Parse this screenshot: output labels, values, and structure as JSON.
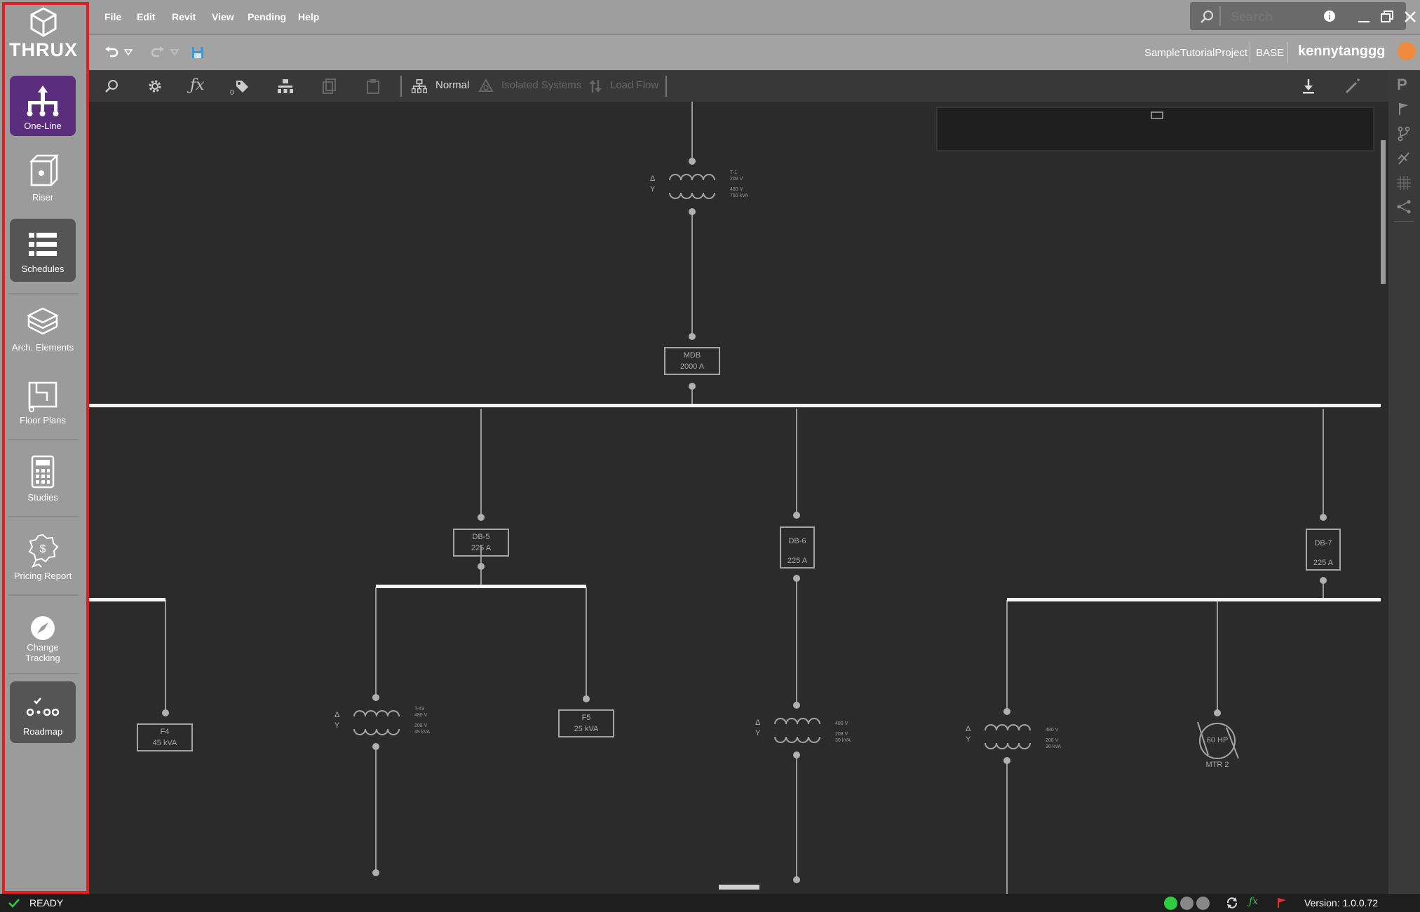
{
  "app": {
    "logo_text": "THRUX",
    "project_name": "SampleTutorialProject",
    "branch": "BASE",
    "username": "kennytanggg"
  },
  "menu": [
    "File",
    "Edit",
    "Revit",
    "View",
    "Pending",
    "Help"
  ],
  "search": {
    "placeholder": "Search"
  },
  "sidebar": {
    "items": [
      {
        "label": "One-Line",
        "icon": "one-line-icon"
      },
      {
        "label": "Riser",
        "icon": "riser-icon"
      },
      {
        "label": "Schedules",
        "icon": "schedules-icon"
      },
      {
        "label": "Arch. Elements",
        "icon": "arch-elements-icon"
      },
      {
        "label": "Floor Plans",
        "icon": "floor-plans-icon"
      },
      {
        "label": "Studies",
        "icon": "calculator-icon"
      },
      {
        "label": "Pricing Report",
        "icon": "pricing-icon"
      },
      {
        "label": "Change Tracking",
        "icon": "compass-icon"
      },
      {
        "label": "Roadmap",
        "icon": "roadmap-icon"
      }
    ]
  },
  "toolbar": {
    "tag_count": "0",
    "mode_normal": "Normal",
    "mode_isolated": "Isolated Systems",
    "mode_loadflow": "Load Flow"
  },
  "diagram": {
    "transformer_t1": {
      "name": "T-1",
      "primary": "208 V",
      "secondary": "480 V",
      "rating": "750 kVA"
    },
    "mdb": {
      "name": "MDB",
      "rating": "2000 A"
    },
    "db5": {
      "name": "DB-5",
      "rating": "225 A"
    },
    "db6": {
      "name": "DB-6",
      "rating": "225 A"
    },
    "db7": {
      "name": "DB-7",
      "rating": "225 A"
    },
    "f4": {
      "name": "F4",
      "rating": "45 kVA"
    },
    "f5": {
      "name": "F5",
      "rating": "25 kVA"
    },
    "t43": {
      "name": "T-43",
      "primary": "480 V",
      "secondary": "208 V",
      "rating": "45 kVA"
    },
    "t_db6": {
      "primary": "480 V",
      "secondary": "208 V",
      "rating": "30 kVA"
    },
    "t_db7": {
      "primary": "480 V",
      "secondary": "208 V",
      "rating": "30 kVA"
    },
    "motor": {
      "rating": "60 HP",
      "name": "MTR 2"
    },
    "delta_symbol": "Δ",
    "wye_symbol": "Y"
  },
  "status": {
    "state": "READY",
    "version": "Version: 1.0.0.72"
  },
  "colors": {
    "sidebar_bg": "#9b9b9b",
    "active_nav": "#5a2d7d",
    "highlight_frame": "#e02020",
    "canvas_bg": "#2b2b2b",
    "avatar": "#f08a3c",
    "status_ok": "#2ecc40"
  }
}
